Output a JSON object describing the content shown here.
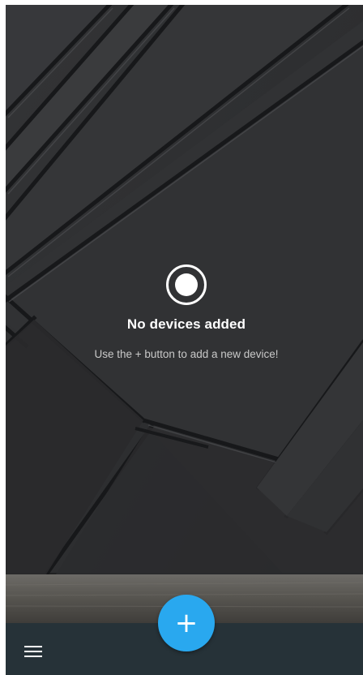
{
  "theme": {
    "accent": "#29a8ef",
    "bottom_bar": "#263238",
    "wallpaper_base": "#2c2d2f",
    "wallpaper_panel": "#37383a",
    "wallpaper_edge": "#171819",
    "floor_color": "#5b5955"
  },
  "empty_state": {
    "icon": "radio-button-icon",
    "title": "No devices added",
    "subtitle": "Use the + button to add a new device!"
  },
  "fab": {
    "label": "+",
    "icon": "plus-icon"
  },
  "bottom_bar": {
    "menu_icon": "hamburger-menu-icon"
  }
}
